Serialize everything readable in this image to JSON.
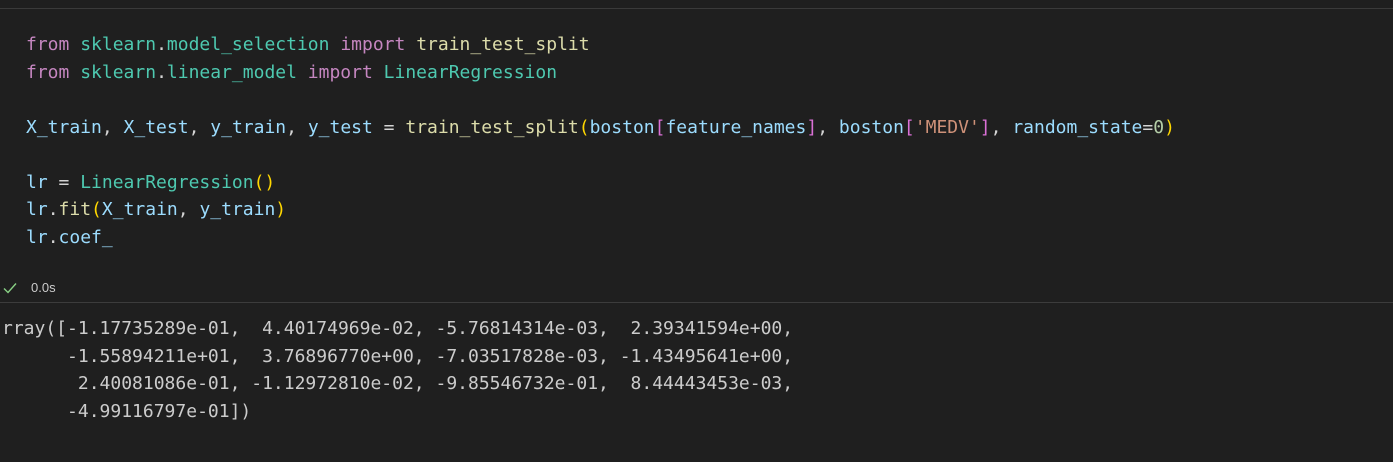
{
  "cell": {
    "code_lines": [
      [
        {
          "t": "from",
          "c": "kw"
        },
        {
          "t": " ",
          "c": "op"
        },
        {
          "t": "sklearn",
          "c": "mod"
        },
        {
          "t": ".",
          "c": "op"
        },
        {
          "t": "model_selection",
          "c": "mod"
        },
        {
          "t": " ",
          "c": "op"
        },
        {
          "t": "import",
          "c": "kw"
        },
        {
          "t": " ",
          "c": "op"
        },
        {
          "t": "train_test_split",
          "c": "fn"
        }
      ],
      [
        {
          "t": "from",
          "c": "kw"
        },
        {
          "t": " ",
          "c": "op"
        },
        {
          "t": "sklearn",
          "c": "mod"
        },
        {
          "t": ".",
          "c": "op"
        },
        {
          "t": "linear_model",
          "c": "mod"
        },
        {
          "t": " ",
          "c": "op"
        },
        {
          "t": "import",
          "c": "kw"
        },
        {
          "t": " ",
          "c": "op"
        },
        {
          "t": "LinearRegression",
          "c": "cls"
        }
      ],
      [],
      [
        {
          "t": "X_train",
          "c": "var"
        },
        {
          "t": ", ",
          "c": "op"
        },
        {
          "t": "X_test",
          "c": "var"
        },
        {
          "t": ", ",
          "c": "op"
        },
        {
          "t": "y_train",
          "c": "var"
        },
        {
          "t": ", ",
          "c": "op"
        },
        {
          "t": "y_test",
          "c": "var"
        },
        {
          "t": " = ",
          "c": "op"
        },
        {
          "t": "train_test_split",
          "c": "fn"
        },
        {
          "t": "(",
          "c": "br1"
        },
        {
          "t": "boston",
          "c": "var"
        },
        {
          "t": "[",
          "c": "br2"
        },
        {
          "t": "feature_names",
          "c": "var"
        },
        {
          "t": "]",
          "c": "br2"
        },
        {
          "t": ", ",
          "c": "op"
        },
        {
          "t": "boston",
          "c": "var"
        },
        {
          "t": "[",
          "c": "br2"
        },
        {
          "t": "'MEDV'",
          "c": "str"
        },
        {
          "t": "]",
          "c": "br2"
        },
        {
          "t": ", ",
          "c": "op"
        },
        {
          "t": "random_state",
          "c": "var"
        },
        {
          "t": "=",
          "c": "op"
        },
        {
          "t": "0",
          "c": "num"
        },
        {
          "t": ")",
          "c": "br1"
        }
      ],
      [],
      [
        {
          "t": "lr",
          "c": "var"
        },
        {
          "t": " = ",
          "c": "op"
        },
        {
          "t": "LinearRegression",
          "c": "cls"
        },
        {
          "t": "()",
          "c": "br1"
        }
      ],
      [
        {
          "t": "lr",
          "c": "var"
        },
        {
          "t": ".",
          "c": "op"
        },
        {
          "t": "fit",
          "c": "fn"
        },
        {
          "t": "(",
          "c": "br1"
        },
        {
          "t": "X_train",
          "c": "var"
        },
        {
          "t": ", ",
          "c": "op"
        },
        {
          "t": "y_train",
          "c": "var"
        },
        {
          "t": ")",
          "c": "br1"
        }
      ],
      [
        {
          "t": "lr",
          "c": "var"
        },
        {
          "t": ".",
          "c": "op"
        },
        {
          "t": "coef_",
          "c": "var"
        }
      ]
    ]
  },
  "status": {
    "icon": "check-icon",
    "exec_time": "0.0s",
    "success_color": "#89d185"
  },
  "output": {
    "lines": [
      "rray([-1.17735289e-01,  4.40174969e-02, -5.76814314e-03,  2.39341594e+00,",
      "      -1.55894211e+01,  3.76896770e+00, -7.03517828e-03, -1.43495641e+00,",
      "       2.40081086e-01, -1.12972810e-02, -9.85546732e-01,  8.44443453e-03,",
      "      -4.99116797e-01])"
    ]
  }
}
